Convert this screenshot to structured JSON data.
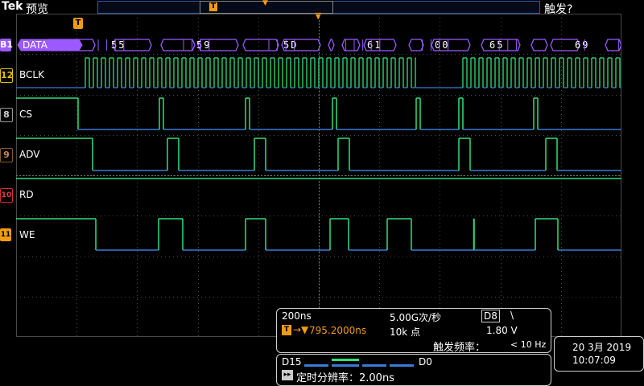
{
  "header": {
    "brand": "Tek",
    "mode": "预览",
    "trigger_status": "触发?",
    "trigger_marker": "T",
    "overview_marker": "T"
  },
  "channels": [
    {
      "id": "B1",
      "name": "DATA",
      "color": "#9b59ff"
    },
    {
      "id": "12",
      "name": "BCLK",
      "color": "#e6c200"
    },
    {
      "id": "8",
      "name": "CS",
      "color": "#9a9a9a"
    },
    {
      "id": "9",
      "name": "ADV",
      "color": "#8a5a2b"
    },
    {
      "id": "10",
      "name": "RD",
      "color": "#d03030"
    },
    {
      "id": "11",
      "name": "WE",
      "color": "#f39c12"
    }
  ],
  "bus_values": [
    "55",
    "59",
    "5D",
    "61",
    "00",
    "65",
    "69"
  ],
  "colors": {
    "high": "#2ee07a",
    "low": "#3a7bd5",
    "grid": "#4a4a4a",
    "bus": "#9b59ff",
    "trigger": "#f39c12"
  },
  "acquisition": {
    "timebase": "200ns",
    "sample_rate": "5.00G次/秒",
    "trigger_source": "D8",
    "trigger_slope": "\\",
    "position": "795.2000ns",
    "record_length": "10k 点",
    "trigger_level": "1.80 V",
    "trigger_freq_label": "触发频率：",
    "trigger_freq_value": "< 10 Hz"
  },
  "digital": {
    "d15": "D15",
    "d0": "D0",
    "resolution": "定时分辨率：2.00ns"
  },
  "datetime": {
    "date": "20 3月 2019",
    "time": "10:07:09"
  }
}
